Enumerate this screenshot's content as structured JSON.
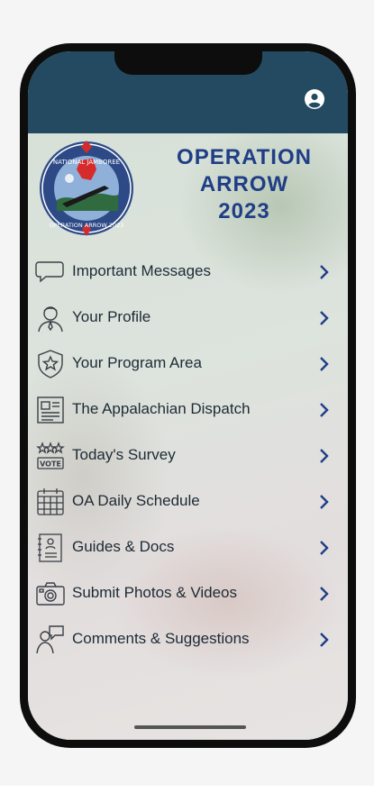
{
  "app": {
    "title_lines": [
      "OPERATION",
      "ARROW",
      "2023"
    ],
    "logo_text": "NATIONAL JAMBOREE · OPERATION ARROW 2023"
  },
  "header": {
    "profile_icon": "account-circle-icon"
  },
  "menu": {
    "items": [
      {
        "label": "Important Messages",
        "icon": "chat-bubble-icon"
      },
      {
        "label": "Your Profile",
        "icon": "person-icon"
      },
      {
        "label": "Your Program Area",
        "icon": "shield-star-icon"
      },
      {
        "label": "The Appalachian Dispatch",
        "icon": "newspaper-icon"
      },
      {
        "label": "Today's Survey",
        "icon": "vote-icon"
      },
      {
        "label": "OA Daily Schedule",
        "icon": "calendar-icon"
      },
      {
        "label": "Guides & Docs",
        "icon": "document-icon"
      },
      {
        "label": "Submit Photos & Videos",
        "icon": "camera-icon"
      },
      {
        "label": "Comments & Suggestions",
        "icon": "feedback-person-icon"
      }
    ]
  },
  "colors": {
    "header": "#234a60",
    "title": "#1f3e86",
    "chevron": "#1f3e86",
    "text": "#1d2a35"
  }
}
